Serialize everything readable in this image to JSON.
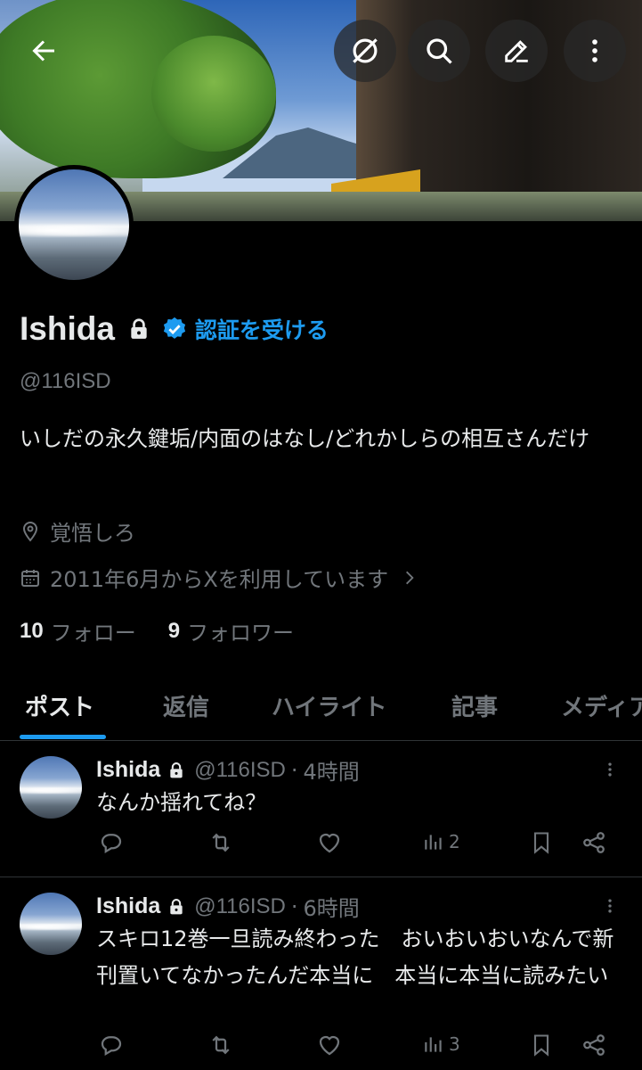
{
  "profile": {
    "display_name": "Ishida",
    "verify_label": "認証を受ける",
    "handle": "@116ISD",
    "bio": "いしだの永久鍵垢/内面のはなし/どれかしらの相互さんだけ",
    "location": "覚悟しろ",
    "joined": "2011年6月からXを利用しています",
    "following_count": "10",
    "following_label": "フォロー",
    "followers_count": "9",
    "followers_label": "フォロワー"
  },
  "tabs": [
    {
      "label": "ポスト",
      "active": true
    },
    {
      "label": "返信",
      "active": false
    },
    {
      "label": "ハイライト",
      "active": false
    },
    {
      "label": "記事",
      "active": false
    },
    {
      "label": "メディア",
      "active": false
    }
  ],
  "posts": [
    {
      "name": "Ishida",
      "handle": "@116ISD",
      "dot": "·",
      "time": "4時間",
      "text": "なんか揺れてね？",
      "views": "2"
    },
    {
      "name": "Ishida",
      "handle": "@116ISD",
      "dot": "·",
      "time": "6時間",
      "text": "スキロ12巻一旦読み終わった　おいおいおいなんで新刊置いてなかったんだ本当に　本当に本当に読みたい",
      "views": "3"
    }
  ],
  "colors": {
    "accent": "#1d9bf0",
    "text": "#e7e9ea",
    "muted": "#71767b",
    "background": "#000000"
  },
  "icons": [
    "back-arrow-icon",
    "hide-icon",
    "search-icon",
    "edit-icon",
    "more-vertical-icon",
    "lock-icon",
    "verified-badge-icon",
    "location-pin-icon",
    "calendar-icon",
    "chevron-right-icon",
    "reply-icon",
    "repost-icon",
    "like-icon",
    "views-icon",
    "bookmark-icon",
    "share-icon"
  ]
}
